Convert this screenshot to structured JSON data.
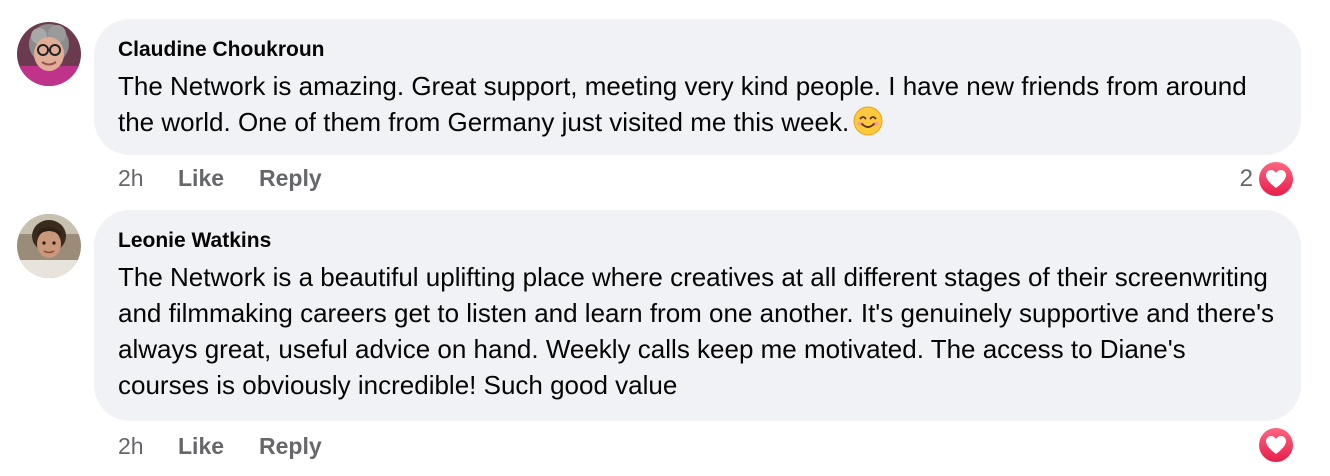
{
  "comments": [
    {
      "author": "Claudine Choukroun",
      "text": "The Network is amazing. Great support, meeting very kind people. I have new friends from around the world. One of them from Germany just visited me this week.",
      "emoji": "smiling-face-emoji",
      "time": "2h",
      "like_label": "Like",
      "reply_label": "Reply",
      "reaction_count": "2",
      "reaction_icon": "love-reaction-icon"
    },
    {
      "author": "Leonie Watkins",
      "text": "The Network is a beautiful uplifting place where creatives at all different stages of their screenwriting and filmmaking careers get to listen and learn from one another. It's genuinely supportive and there's always great, useful advice on hand. Weekly calls keep me motivated. The access to Diane's courses is obviously incredible! Such good value",
      "time": "2h",
      "like_label": "Like",
      "reply_label": "Reply",
      "reaction_icon": "love-reaction-icon"
    }
  ],
  "colors": {
    "bubble_bg": "#f0f2f5",
    "meta_text": "#65676b",
    "love_reaction": "#f33e58"
  }
}
